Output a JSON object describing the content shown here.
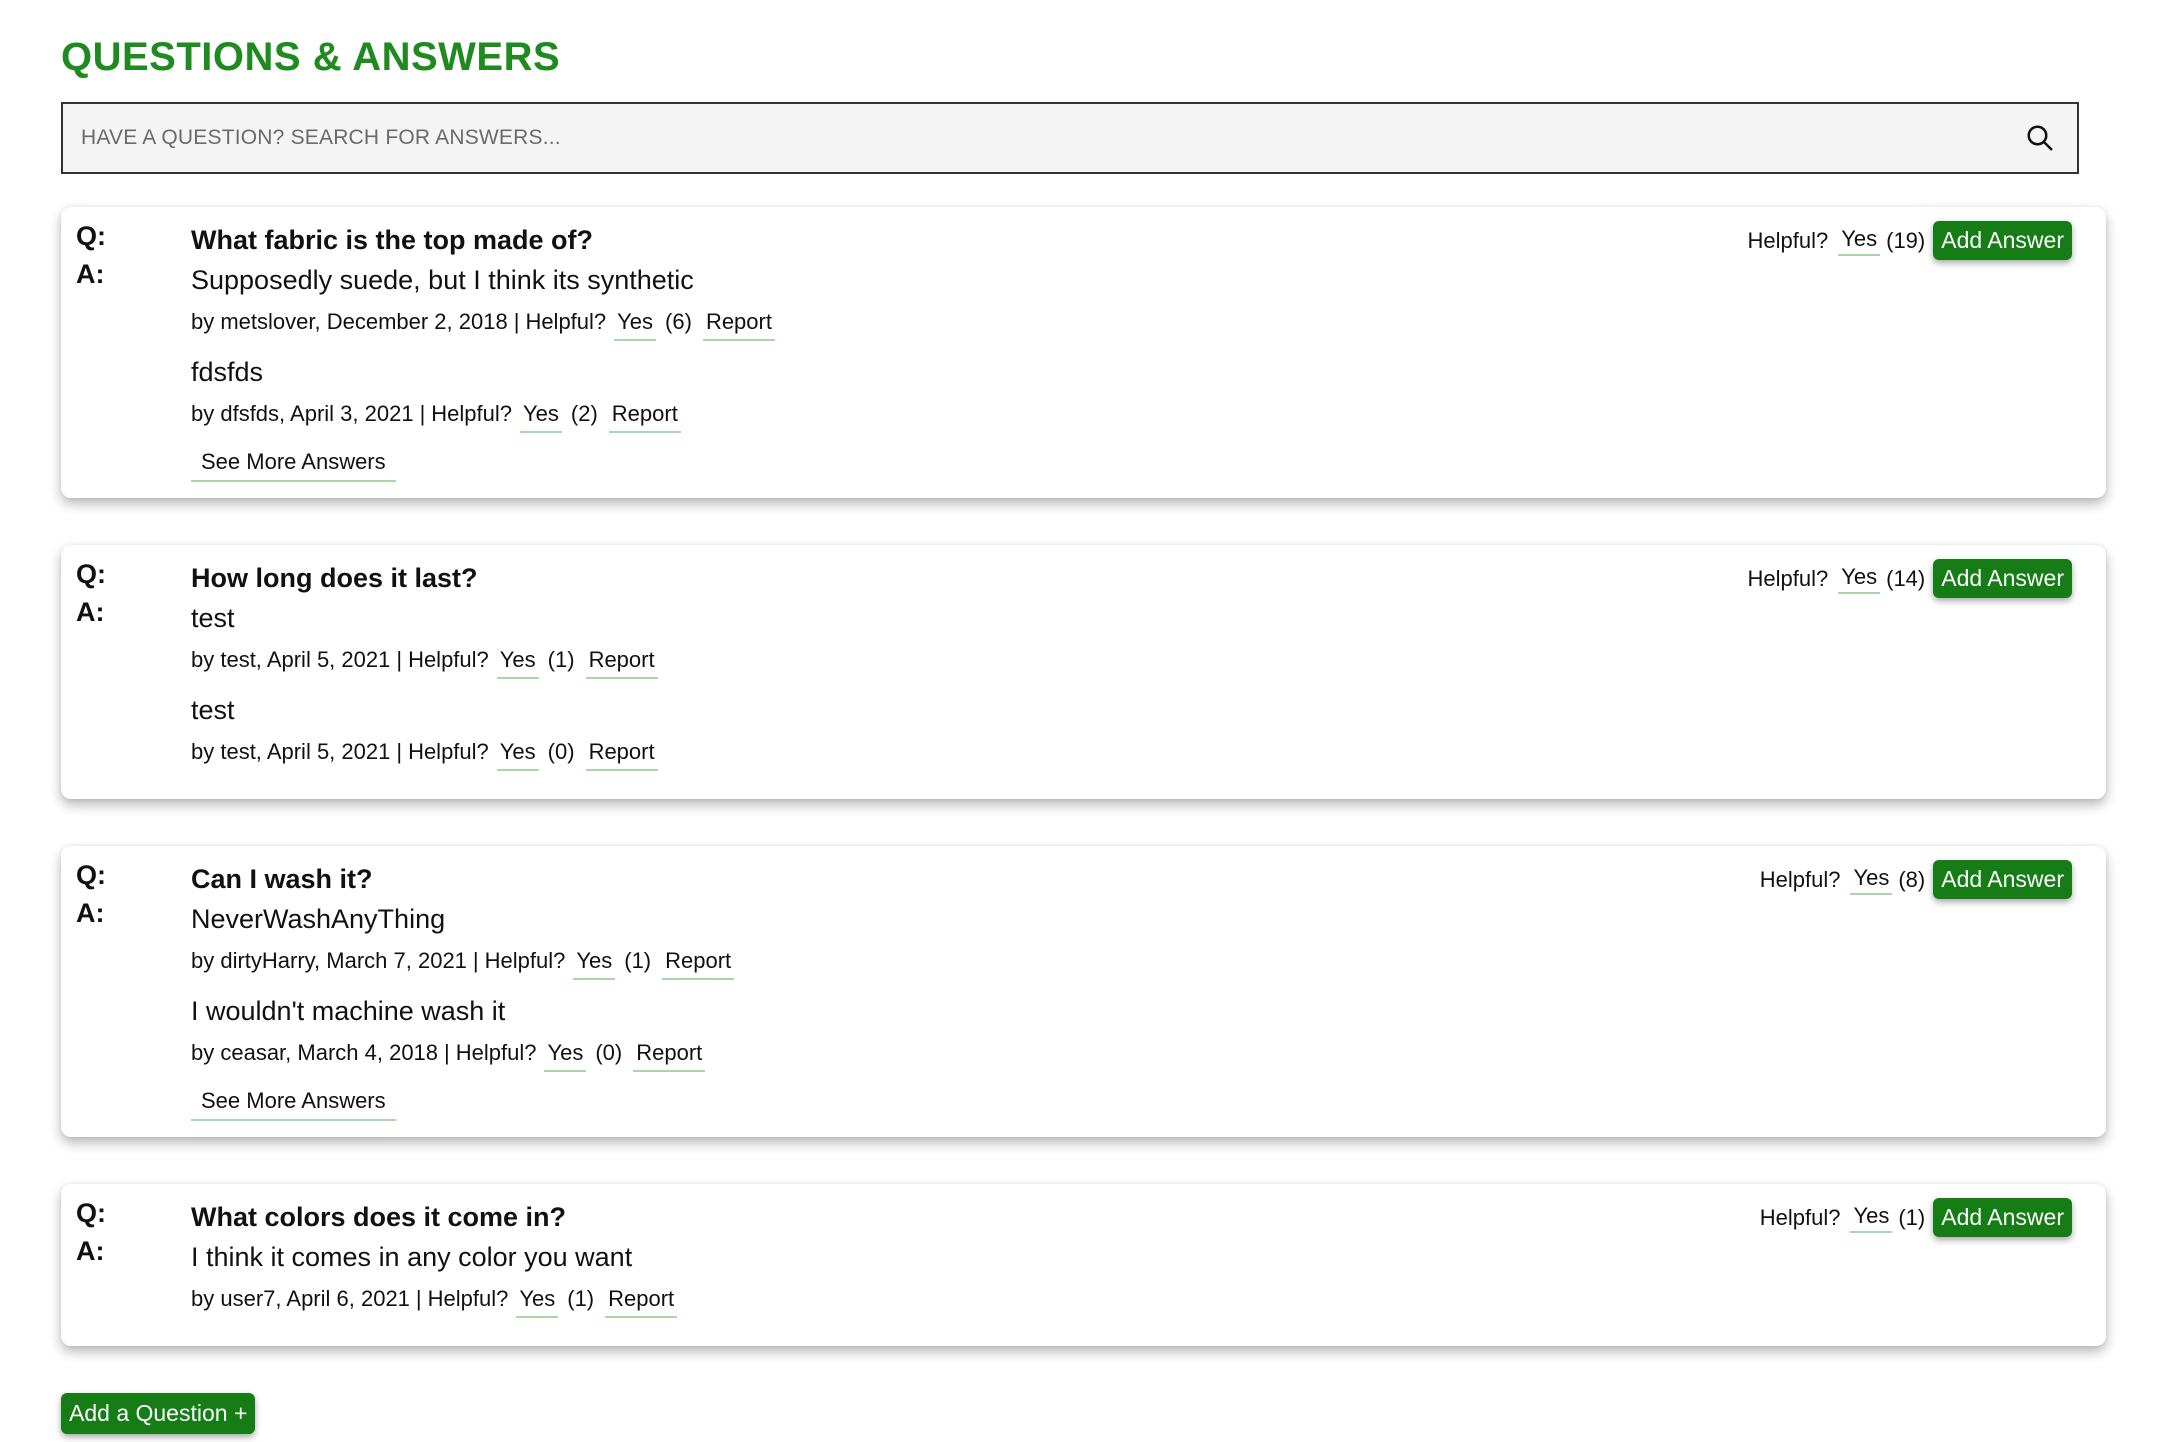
{
  "header": {
    "title": "QUESTIONS & ANSWERS"
  },
  "search": {
    "placeholder": "HAVE A QUESTION? SEARCH FOR ANSWERS..."
  },
  "labels": {
    "q": "Q:",
    "a": "A:",
    "helpful": "Helpful?",
    "yes": "Yes",
    "report": "Report",
    "add_answer": "Add Answer",
    "see_more": "See More Answers",
    "by": "by",
    "sep": "|"
  },
  "questions": [
    {
      "question": "What fabric is the top made of?",
      "helpful_count": "(19)",
      "answers": [
        {
          "text": "Supposedly suede, but I think its synthetic",
          "meta": "by metslover, December 2, 2018",
          "count": "(6)"
        },
        {
          "text": "fdsfds",
          "meta": "by dfsfds, April 3, 2021",
          "count": "(2)"
        }
      ]
    },
    {
      "question": "How long does it last?",
      "helpful_count": "(14)",
      "answers": [
        {
          "text": "test",
          "meta": "by test, April 5, 2021",
          "count": "(1)"
        },
        {
          "text": "test",
          "meta": "by test, April 5, 2021",
          "count": "(0)"
        }
      ]
    },
    {
      "question": "Can I wash it?",
      "helpful_count": "(8)",
      "answers": [
        {
          "text": "NeverWashAnyThing",
          "meta": "by dirtyHarry, March 7, 2021",
          "count": "(1)"
        },
        {
          "text": "I wouldn't machine wash it",
          "meta": "by ceasar, March 4, 2018",
          "count": "(0)"
        }
      ]
    },
    {
      "question": "What colors does it come in?",
      "helpful_count": "(1)",
      "answers": [
        {
          "text": "I think it comes in any color you want",
          "meta": "by user7, April 6, 2021",
          "count": "(1)"
        }
      ]
    }
  ],
  "footer": {
    "add_question": "Add a Question +"
  },
  "colors": {
    "brand_green": "#1f8a1f",
    "button_green": "#167d16",
    "underline_green": "#a8d8a8"
  },
  "icons": {
    "search": "search-icon"
  }
}
